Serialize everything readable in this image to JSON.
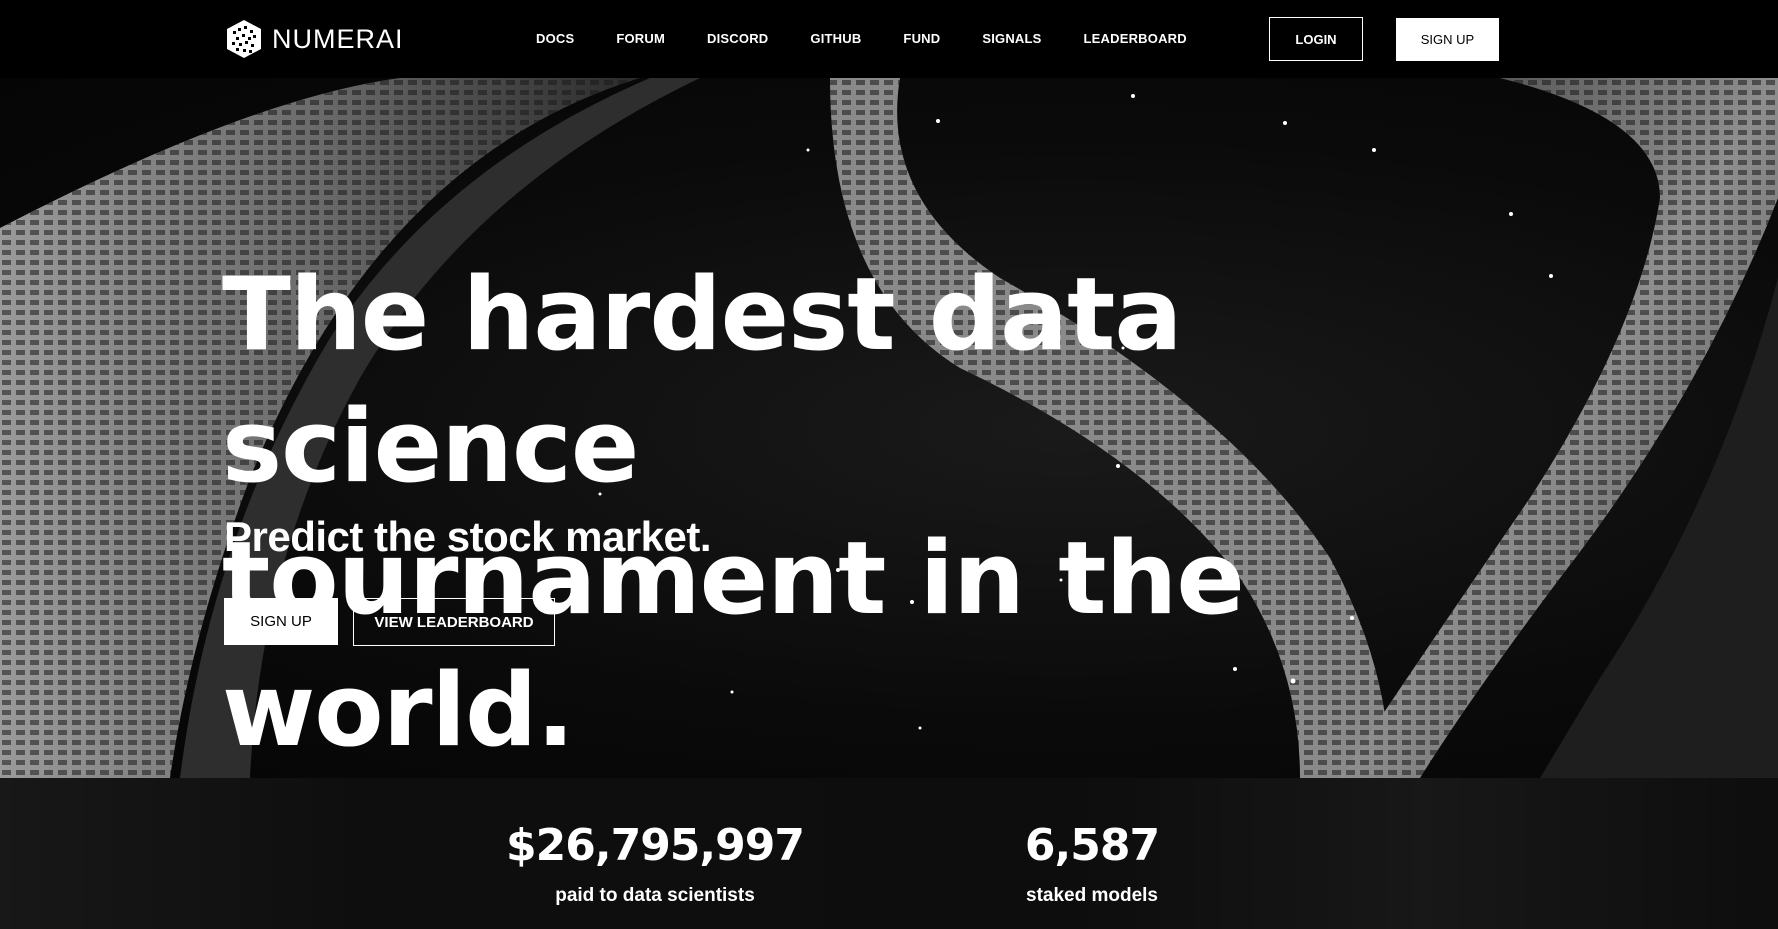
{
  "brand": {
    "name": "NUMERAI",
    "logo_icon": "cube-logo-icon"
  },
  "nav": {
    "links": [
      "DOCS",
      "FORUM",
      "DISCORD",
      "GITHUB",
      "FUND",
      "SIGNALS",
      "LEADERBOARD"
    ],
    "login_label": "LOGIN",
    "signup_label": "SIGN UP"
  },
  "hero": {
    "headline_line1": "The hardest data science",
    "headline_line2": "tournament in the world.",
    "subheadline": "Predict the stock market.",
    "signup_label": "SIGN UP",
    "leaderboard_label": "VIEW LEADERBOARD"
  },
  "stats": [
    {
      "value": "$26,795,997",
      "label": "paid to data scientists"
    },
    {
      "value": "6,587",
      "label": "staked models"
    }
  ],
  "colors": {
    "background": "#000000",
    "text": "#ffffff",
    "button_fill": "#ffffff"
  }
}
